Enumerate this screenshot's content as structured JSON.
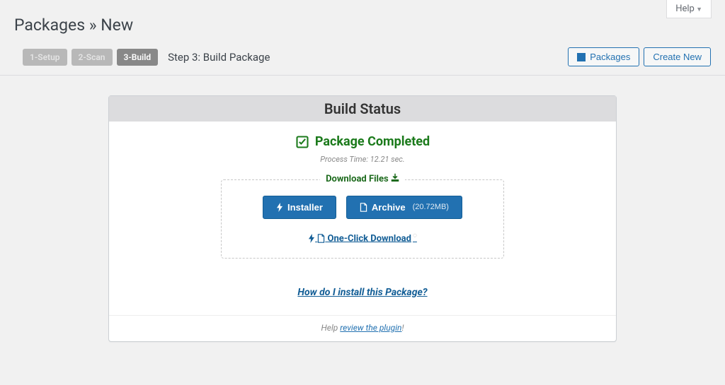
{
  "help_label": "Help",
  "page_title": "Packages » New",
  "steps": {
    "s1": "1-Setup",
    "s2": "2-Scan",
    "s3": "3-Build",
    "caption": "Step 3: Build Package"
  },
  "toolbar": {
    "packages_label": "Packages",
    "create_new_label": "Create New"
  },
  "card": {
    "title": "Build Status",
    "status_label": "Package Completed",
    "process_time": "Process Time: 12.21 sec."
  },
  "downloads": {
    "legend": "Download Files",
    "installer_label": "Installer",
    "archive_label": "Archive",
    "archive_size": "(20.72MB)",
    "one_click_label": "One-Click Download"
  },
  "install_question": "How do I install this Package?",
  "footer": {
    "help_prefix": "Help",
    "review_link": "review the plugin",
    "exclaim": "!"
  }
}
